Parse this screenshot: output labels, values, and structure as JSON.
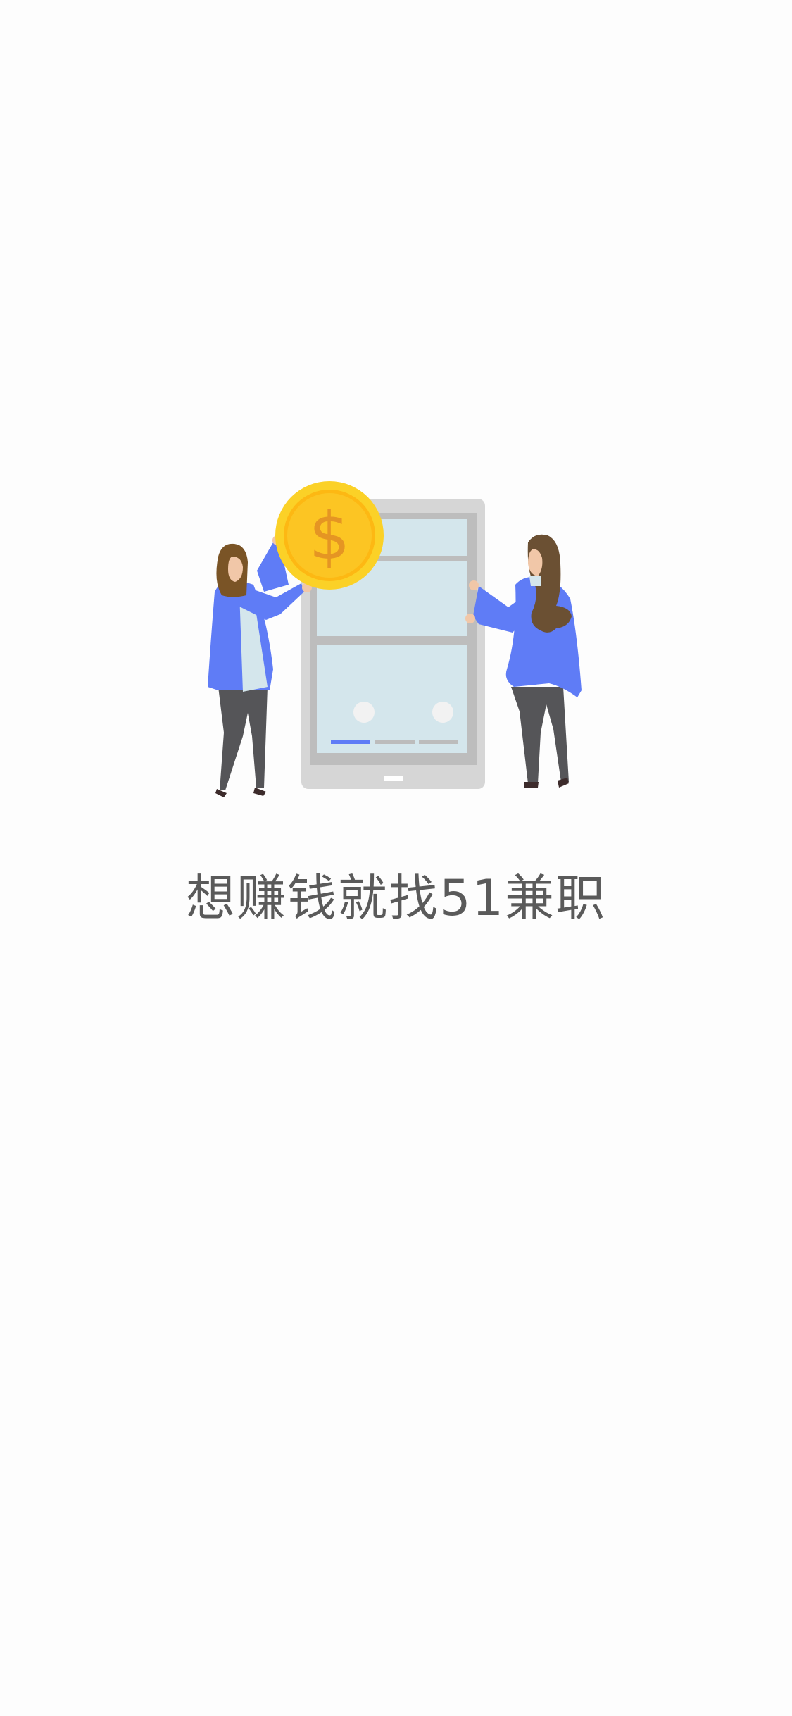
{
  "splash": {
    "slogan": "想赚钱就找51兼职",
    "illustration": {
      "name": "promo-illustration",
      "coin_symbol": "$"
    }
  },
  "colors": {
    "background": "#fdfdfd",
    "slogan_text": "#5a5a5a",
    "accent_blue": "#5f7cf6",
    "coin_gold": "#fbd127",
    "screen_glass": "#d4e6ec"
  }
}
